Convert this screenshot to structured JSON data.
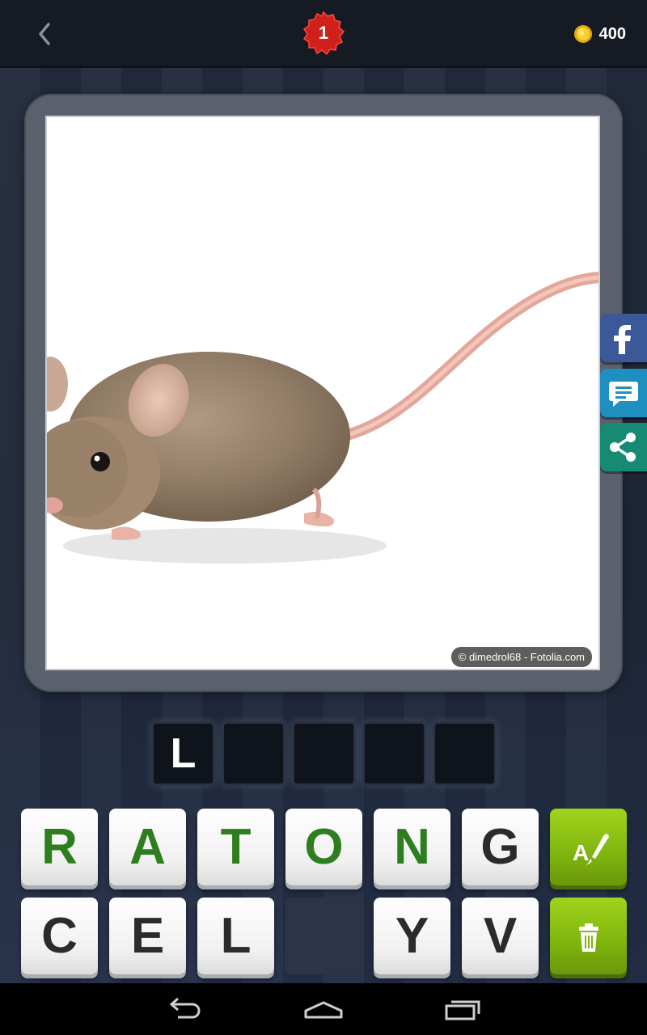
{
  "header": {
    "back_icon": "chevron-left-icon",
    "level": "1",
    "coins": "400",
    "coin_icon": "gold-coin-icon",
    "badge_color": "#d0201c"
  },
  "puzzle": {
    "image_subject": "mouse-photo",
    "credit": "© dimedrol68 - Fotolia.com",
    "answer_slots": [
      "L",
      "",
      "",
      "",
      ""
    ]
  },
  "share": {
    "facebook_icon": "facebook-icon",
    "message_icon": "chat-bubble-icon",
    "share_icon": "share-icon"
  },
  "keyboard": {
    "row1": [
      "R",
      "A",
      "T",
      "O",
      "N",
      "G"
    ],
    "row2": [
      "C",
      "E",
      "L",
      "",
      "Y",
      "V"
    ],
    "reveal_letter_icon": "reveal-letter-icon",
    "remove_letters_icon": "trash-icon",
    "green_letters": [
      "R",
      "A",
      "T",
      "O",
      "N"
    ],
    "accent": "#8cc414"
  },
  "navigation": {
    "back": "back-arrow-icon",
    "home": "home-icon",
    "recents": "recent-apps-icon"
  }
}
